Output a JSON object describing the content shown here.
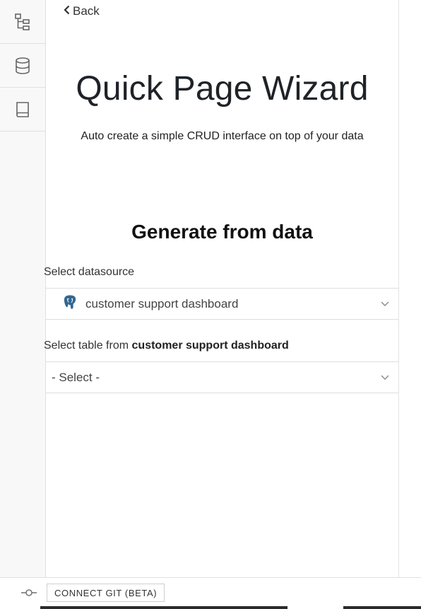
{
  "sidebar": {
    "items": [
      {
        "icon": "tree-icon"
      },
      {
        "icon": "database-icon"
      },
      {
        "icon": "book-icon"
      }
    ]
  },
  "nav": {
    "back_label": "Back"
  },
  "header": {
    "title": "Quick Page Wizard",
    "subtitle": "Auto create a simple CRUD interface on top of your data"
  },
  "form": {
    "section_title": "Generate from data",
    "datasource_label": "Select datasource",
    "datasource_value": "customer support dashboard",
    "datasource_icon": "postgres-icon",
    "table_label_prefix": "Select table from",
    "table_label_source": "customer support dashboard",
    "table_value": "- Select -"
  },
  "footer": {
    "git_button_label": "CONNECT GIT (BETA)"
  },
  "colors": {
    "sidebar_bg": "#f8f8f8",
    "border": "#e0e0e0",
    "postgres_blue": "#336791"
  }
}
